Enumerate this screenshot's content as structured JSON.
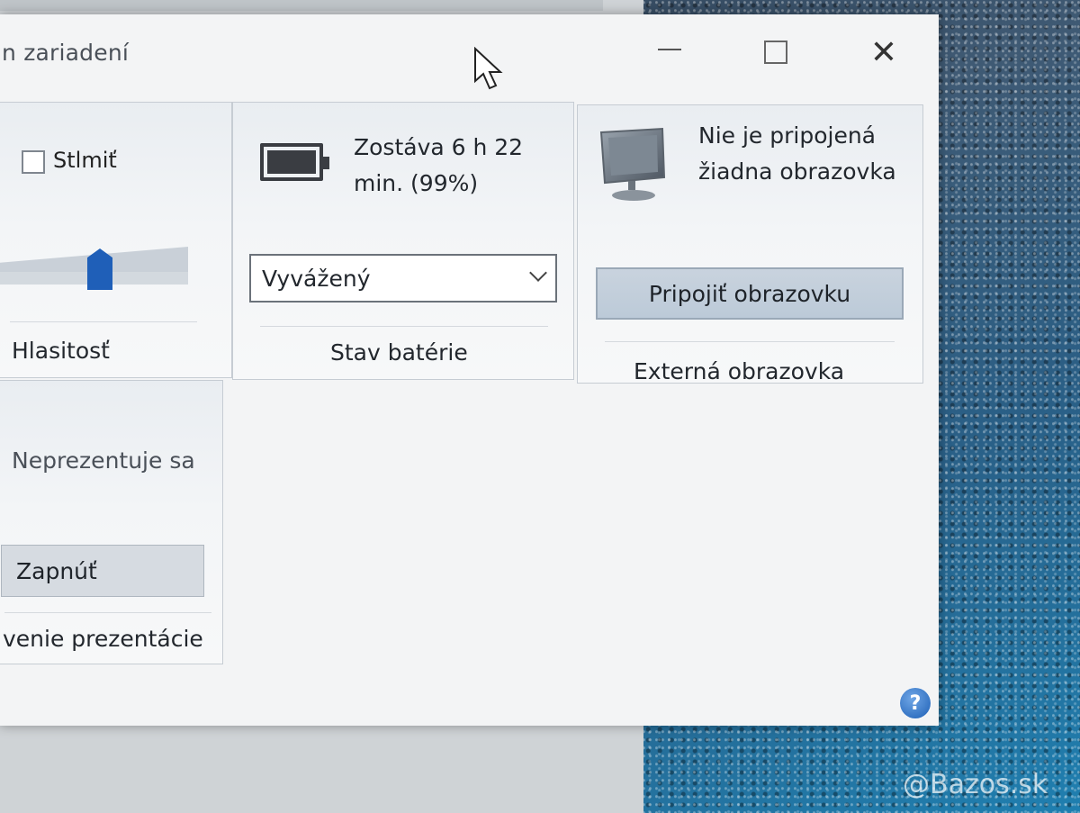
{
  "window": {
    "title": "n zariadení"
  },
  "volume": {
    "mute_label": "Stlmiť",
    "mute_checked": false,
    "level_percent": 50,
    "tile_label": "Hlasitosť"
  },
  "battery": {
    "status": "Zostáva 6 h 22 min. (99%)",
    "percent": 99,
    "power_plan": "Vyvážený",
    "tile_label": "Stav batérie"
  },
  "display": {
    "status": "Nie je pripojená žiadna obrazovka",
    "connect_button": "Pripojiť obrazovku",
    "tile_label": "Externá obrazovka"
  },
  "presentation": {
    "status": "Neprezentuje sa",
    "button": "Zapnúť",
    "tile_label": "venie prezentácie"
  },
  "help": {
    "icon": "help-icon",
    "glyph": "?"
  },
  "watermark": "@Bazos.sk",
  "colors": {
    "accent": "#1f5fb8",
    "tile_background": "#f3f5f7",
    "button_highlight": "#c9d3de"
  }
}
